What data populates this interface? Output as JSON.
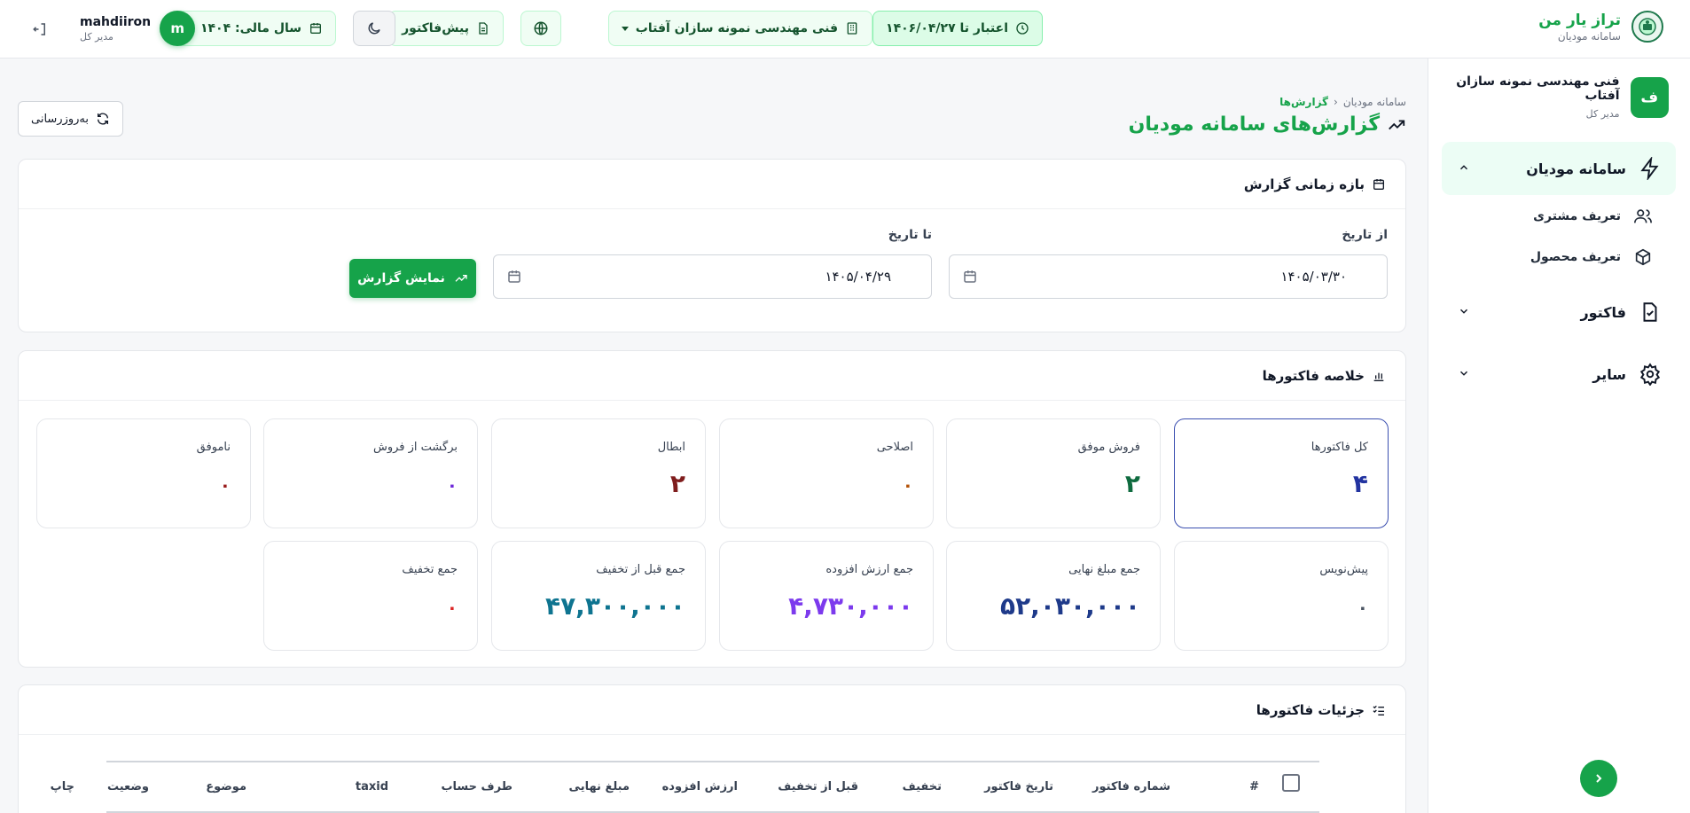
{
  "brand": {
    "name": "تراز یار من",
    "subtitle": "سامانه مودیان"
  },
  "header": {
    "validity": "اعتبار تا ۱۴۰۶/۰۴/۲۷",
    "company": "فنی مهندسی نمونه سازان آفتاب",
    "prefactor": "پیش‌فاکتور",
    "fiscal_year": "سال مالی: ۱۴۰۴",
    "user": {
      "name": "mahdiiron",
      "role": "مدیر کل",
      "initial": "m"
    }
  },
  "sidebar": {
    "org": {
      "initial": "ف",
      "name": "فنی مهندسی نمونه سازان آفتاب",
      "role": "مدیر کل"
    },
    "groups": [
      {
        "label": "سامانه مودیان",
        "icon": "lightning-icon",
        "expanded": true,
        "items": [
          {
            "label": "تعریف مشتری",
            "icon": "users-icon"
          },
          {
            "label": "تعریف محصول",
            "icon": "box-icon"
          }
        ]
      },
      {
        "label": "فاکتور",
        "icon": "invoice-icon",
        "expanded": false
      },
      {
        "label": "سایر",
        "icon": "gear-icon",
        "expanded": false
      }
    ]
  },
  "breadcrumb": {
    "root": "سامانه مودیان",
    "current": "گزارش‌ها"
  },
  "page": {
    "title": "گزارش‌های سامانه مودیان",
    "refresh": "به‌روزرسانی"
  },
  "range": {
    "title": "بازه زمانی گزارش",
    "from_label": "از تاریخ",
    "from_value": "۱۴۰۵/۰۳/۳۰",
    "to_label": "تا تاریخ",
    "to_value": "۱۴۰۵/۰۴/۲۹",
    "show_button": "نمایش گزارش"
  },
  "summary": {
    "title": "خلاصه فاکتورها",
    "stats": [
      {
        "label": "کل فاکتورها",
        "value": "۴",
        "color": "#2233a0",
        "selected": true
      },
      {
        "label": "فروش موفق",
        "value": "۲",
        "color": "#0f6b3f"
      },
      {
        "label": "اصلاحی",
        "value": "۰",
        "color": "#b45309"
      },
      {
        "label": "ابطال",
        "value": "۲",
        "color": "#7f1d1d"
      },
      {
        "label": "برگشت از فروش",
        "value": "۰",
        "color": "#6d28d9"
      },
      {
        "label": "ناموفق",
        "value": "۰",
        "color": "#991b1b"
      },
      {
        "label": "پیش‌نویس",
        "value": "۰",
        "color": "#4b5563"
      },
      {
        "label": "جمع مبلغ نهایی",
        "value": "۵۲,۰۳۰,۰۰۰",
        "color": "#1e3a8a"
      },
      {
        "label": "جمع ارزش افزوده",
        "value": "۴,۷۳۰,۰۰۰",
        "color": "#7c3aed"
      },
      {
        "label": "جمع قبل از تخفیف",
        "value": "۴۷,۳۰۰,۰۰۰",
        "color": "#0e7490"
      },
      {
        "label": "جمع تخفیف",
        "value": "۰",
        "color": "#dc2626"
      }
    ]
  },
  "details": {
    "title": "جزئیات فاکتورها",
    "columns": [
      "#",
      "شماره فاکتور",
      "تاریخ فاکتور",
      "تخفیف",
      "قبل از تخفیف",
      "ارزش افزوده",
      "مبلغ نهایی",
      "طرف حساب",
      "taxid",
      "موضوع",
      "وضعیت",
      "چاپ"
    ]
  }
}
